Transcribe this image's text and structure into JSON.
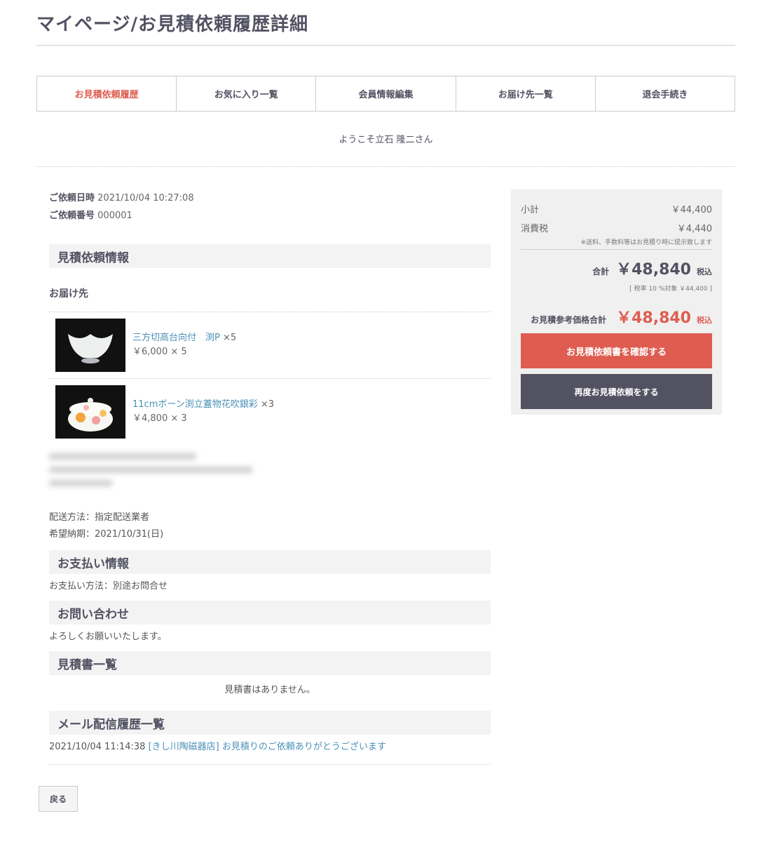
{
  "page_title": "マイページ/お見積依頼履歴詳細",
  "nav": [
    {
      "label": "お見積依頼履歴",
      "active": true
    },
    {
      "label": "お気に入り一覧",
      "active": false
    },
    {
      "label": "会員情報編集",
      "active": false
    },
    {
      "label": "お届け先一覧",
      "active": false
    },
    {
      "label": "退会手続き",
      "active": false
    }
  ],
  "welcome": "ようこそ立石 隆二さん",
  "order": {
    "date_label": "ご依頼日時",
    "date_value": "2021/10/04 10:27:08",
    "number_label": "ご依頼番号",
    "number_value": "000001"
  },
  "sections": {
    "estimate_info": "見積依頼情報",
    "delivery_to": "お届け先",
    "payment_info": "お支払い情報",
    "inquiry": "お問い合わせ",
    "quotes": "見積書一覧",
    "mail_history": "メール配信履歴一覧"
  },
  "items": [
    {
      "name": "三方切高台向付　渕P",
      "qty": "×5",
      "price_line": "￥6,000 × 5"
    },
    {
      "name": "11cmボーン渕立蓋物花吹銀彩",
      "qty": "×3",
      "price_line": "￥4,800 × 3"
    }
  ],
  "delivery": {
    "method": "配送方法：指定配送業者",
    "date": "希望納期：2021/10/31(日)"
  },
  "payment": {
    "method": "お支払い方法：別途お問合せ"
  },
  "inquiry_text": "よろしくお願いいたします。",
  "quotes_empty": "見積書はありません。",
  "mail": {
    "timestamp": "2021/10/04 11:14:38",
    "subject": "[きし川陶磁器店] お見積りのご依頼ありがとうございます"
  },
  "back_button": "戻る",
  "summary": {
    "subtotal_label": "小計",
    "subtotal_value": "￥44,400",
    "tax_label": "消費税",
    "tax_value": "￥4,440",
    "shipping_note": "※送料、手数料等はお見積り時に提示致します",
    "total_label": "合計",
    "total_value": "￥48,840",
    "tax_in": "税込",
    "tax_rate_note": "[ 税率 10 %対象  ￥44,400 ]",
    "ref_label": "お見積参考価格合計",
    "ref_value": "￥48,840",
    "ref_tax_in": "税込",
    "confirm_button": "お見積依頼書を確認する",
    "reorder_button": "再度お見積依頼をする"
  },
  "colors": {
    "accent": "#de5d50",
    "dark": "#525263",
    "link": "#4a90b8",
    "panel": "#f0f0f0"
  }
}
